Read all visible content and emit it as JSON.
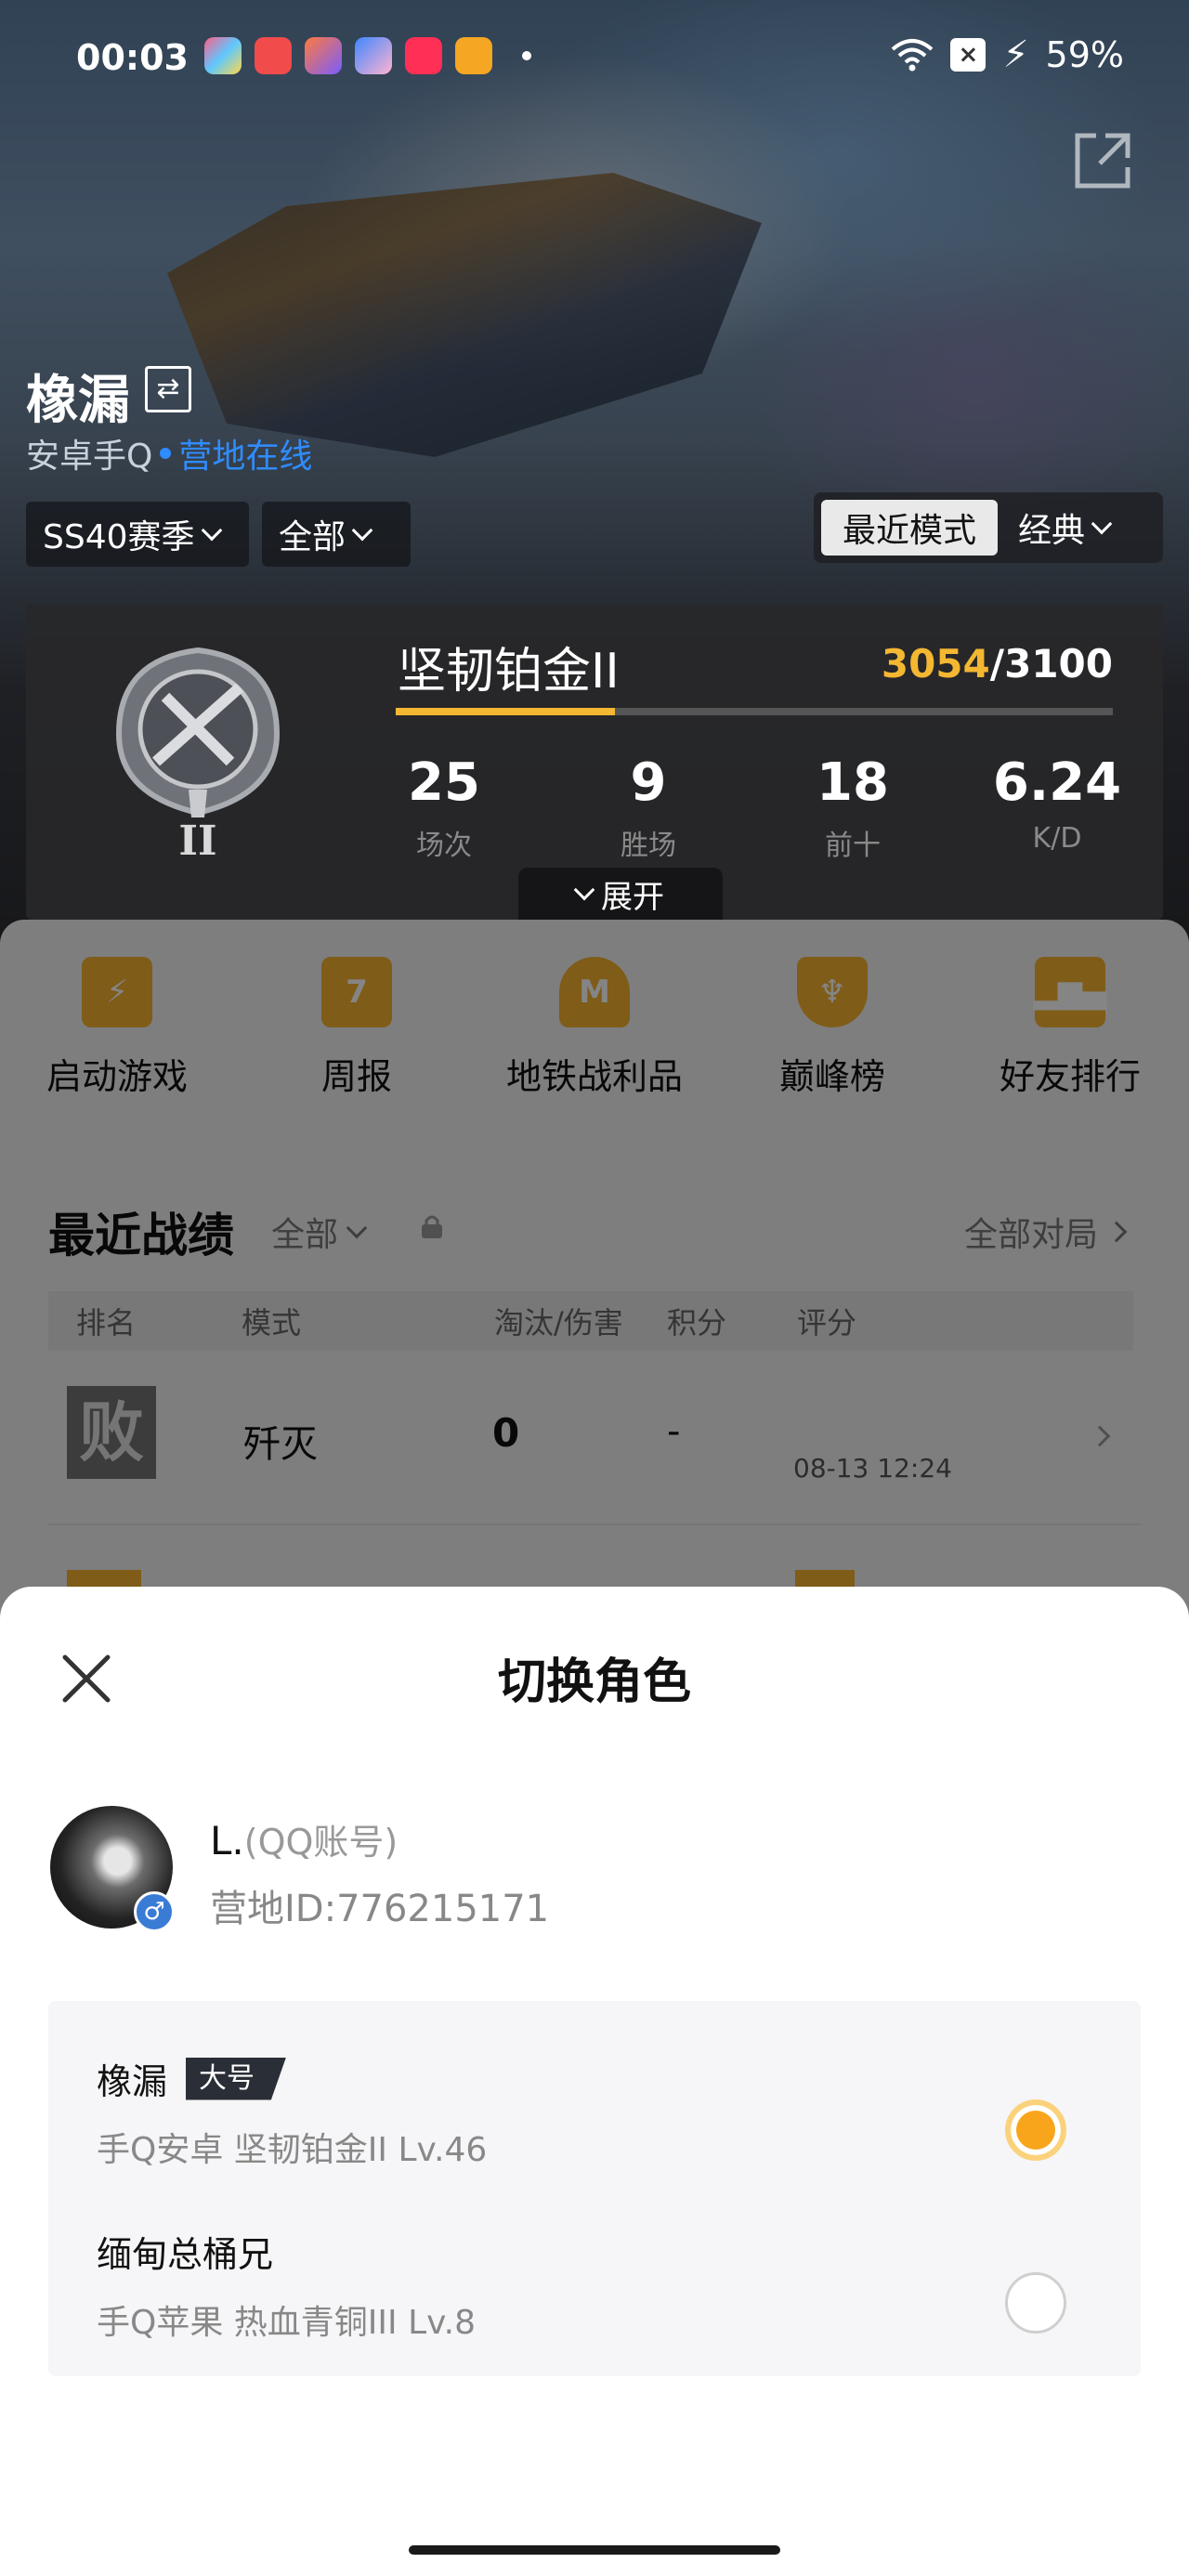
{
  "status_bar": {
    "time": "00:03",
    "battery": "59%"
  },
  "profile": {
    "name": "橡漏",
    "platform": "安卓手Q",
    "online_status": "营地在线",
    "season_filter": "SS40赛季",
    "scope_filter": "全部",
    "mode_active": "最近模式",
    "mode_classic": "经典"
  },
  "rank": {
    "title": "坚韧铂金II",
    "points_current": "3054",
    "points_total": "/3100",
    "progress_fraction": 0.306,
    "emblem_numeral": "II",
    "stats": [
      {
        "value": "25",
        "label": "场次"
      },
      {
        "value": "9",
        "label": "胜场"
      },
      {
        "value": "18",
        "label": "前十"
      },
      {
        "value": "6.24",
        "label": "K/D"
      }
    ],
    "expand_label": "展开"
  },
  "quick_actions": [
    {
      "label": "启动游戏",
      "icon": "lightning-icon"
    },
    {
      "label": "周报",
      "icon": "calendar-icon",
      "glyph": "7"
    },
    {
      "label": "地铁战利品",
      "icon": "metro-icon",
      "glyph": "M"
    },
    {
      "label": "巅峰榜",
      "icon": "peak-shield-icon"
    },
    {
      "label": "好友排行",
      "icon": "podium-icon"
    }
  ],
  "records": {
    "title": "最近战绩",
    "filter": "全部",
    "all_matches": "全部对局",
    "headers": {
      "rank": "排名",
      "mode": "模式",
      "kills": "淘汰/伤害",
      "points": "积分",
      "rating": "评分"
    },
    "rows": [
      {
        "rank_glyph": "败",
        "mode": "歼灭",
        "kills": "0",
        "points": "-",
        "time": "08-13 12:24"
      }
    ]
  },
  "sheet": {
    "title": "切换角色",
    "account_name": "L.",
    "account_type": "(QQ账号)",
    "camp_id": "营地ID:776215171",
    "gender_symbol": "♂",
    "roles": [
      {
        "name": "橡漏",
        "tag": "大号",
        "info": "手Q安卓  坚韧铂金II  Lv.46",
        "selected": true
      },
      {
        "name": "缅甸总桶兄",
        "tag": "",
        "info": "手Q苹果  热血青铜III  Lv.8",
        "selected": false
      }
    ]
  },
  "colors": {
    "accent": "#f4b731",
    "online": "#2f8cff",
    "radio_selected": "#f8a51c"
  }
}
